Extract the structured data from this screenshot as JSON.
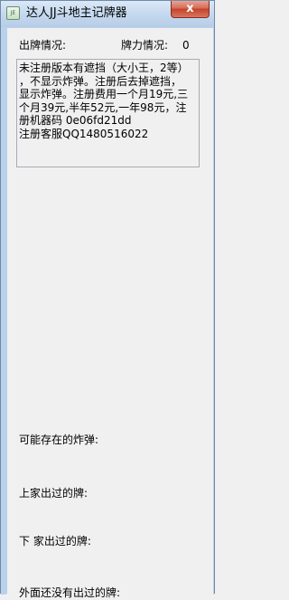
{
  "window": {
    "title": "达人JJ斗地主记牌器",
    "icon_text": "JE",
    "close_glyph": "x"
  },
  "labels": {
    "played_cards": "出牌情况:",
    "hand_strength": "牌力情况:",
    "hand_strength_value": "0",
    "possible_bombs": "可能存在的炸弹:",
    "upper_player_played": "上家出过的牌:",
    "lower_player_played": "下 家出过的牌:",
    "others_unplayed": "外面还没有出过的牌:"
  },
  "info_box": {
    "lines": [
      "未注册版本有遮挡（大小王，2等）",
      "，不显示炸弹。注册后去掉遮挡，",
      "显示炸弹。注册费用一个月19元,三",
      "个月39元,半年52元,一年98元，注",
      "册机器码 0e06fd21dd",
      "注册客服QQ1480516022"
    ]
  }
}
